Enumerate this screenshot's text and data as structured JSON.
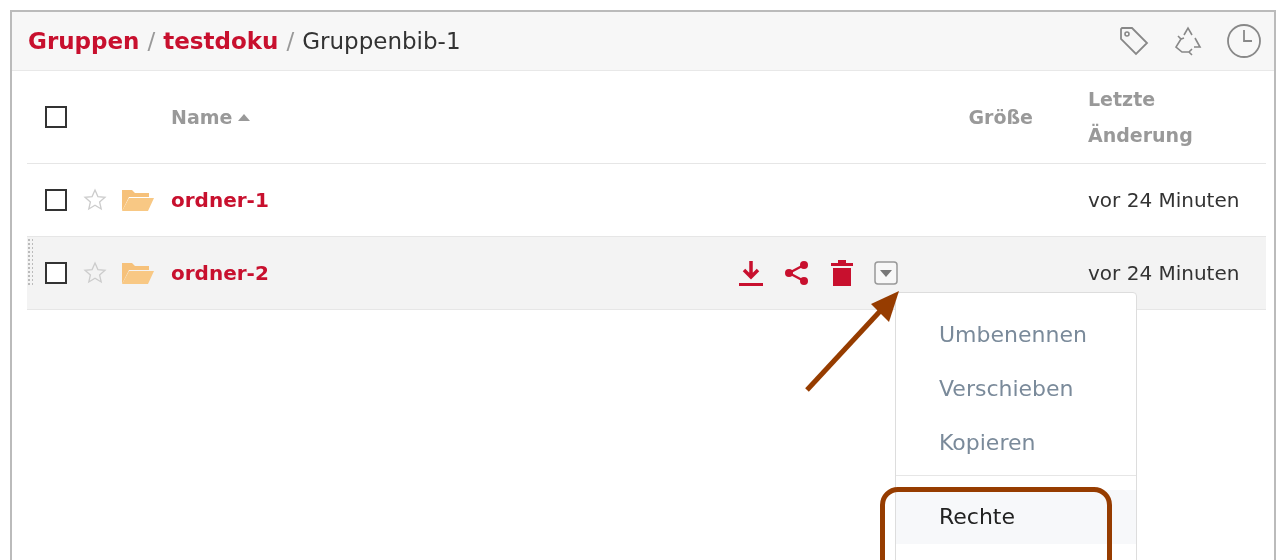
{
  "breadcrumb": [
    {
      "label": "Gruppen",
      "kind": "link"
    },
    {
      "label": "/",
      "kind": "separator"
    },
    {
      "label": "testdoku",
      "kind": "link"
    },
    {
      "label": "/",
      "kind": "separator"
    },
    {
      "label": "Gruppenbib-1",
      "kind": "current"
    }
  ],
  "table": {
    "select_all": {
      "checked": false
    },
    "columns": [
      {
        "label": "Name",
        "sorted": true
      },
      {
        "label": "Größe",
        "sorted": false
      },
      {
        "label": "Letzte Änderung",
        "sorted": false
      }
    ],
    "rows": [
      {
        "checked": false,
        "starred": false,
        "name": "ordner-1",
        "modified": "vor 24 Minuten",
        "highlighted": false
      },
      {
        "checked": false,
        "starred": false,
        "name": "ordner-2",
        "modified": "vor 24 Minuten",
        "highlighted": true
      }
    ]
  },
  "context_menu": {
    "items": [
      {
        "label": "Umbenennen",
        "highlighted": false
      },
      {
        "label": "Verschieben",
        "highlighted": false
      },
      {
        "label": "Kopieren",
        "highlighted": false
      },
      {
        "label": "Rechte",
        "highlighted": true
      }
    ]
  }
}
